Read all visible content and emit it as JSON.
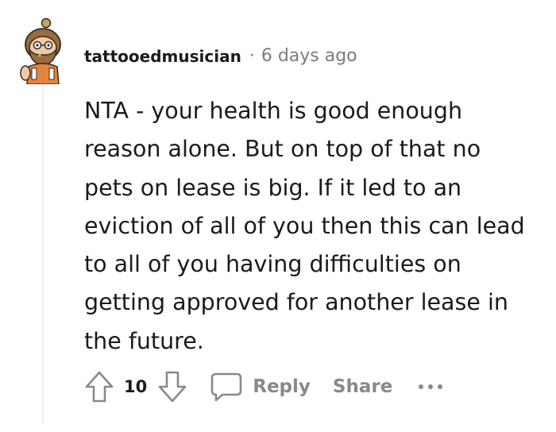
{
  "comment": {
    "author": "tattooedmusician",
    "separator": "·",
    "time_ago": "6 days ago",
    "body_lines": [
      "NTA - your health is good enough",
      "reason alone. But on top of that no",
      "pets on lease is big. If it led to an",
      "eviction of all of you then this can lead",
      "to all of you having difficulties on",
      "getting approved for another lease in",
      "the future."
    ]
  },
  "actions": {
    "score": "10",
    "reply_label": "Reply",
    "share_label": "Share"
  },
  "icons": {
    "avatar": "snoo-avatar-icon",
    "upvote": "upvote-arrow-icon",
    "downvote": "downvote-arrow-icon",
    "comment": "speech-bubble-icon",
    "more": "more-options-icon"
  },
  "colors": {
    "meta_text": "#7c7c7c",
    "action_text": "#878a8c",
    "thread_line": "#edeff1"
  }
}
